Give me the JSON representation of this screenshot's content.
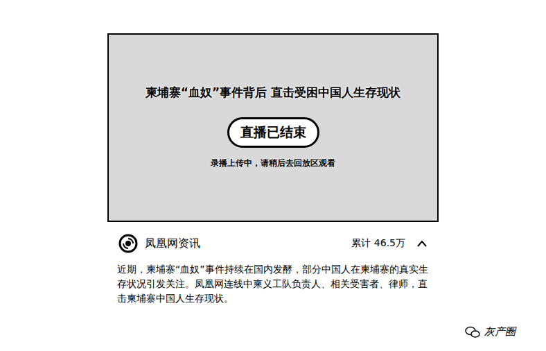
{
  "video": {
    "title": "柬埔寨“血奴”事件背后 直击受困中国人生存现状",
    "status": "直播已结束",
    "notice": "录播上传中，请稍后去回放区观看"
  },
  "channel": {
    "name": "凤凰网资讯",
    "views_label": "累计",
    "views": "46.5万"
  },
  "description": "近期，柬埔寨“血奴”事件持续在国内发酵，部分中国人在柬埔寨的真实生存状况引发关注。凤凰网连线中柬义工队负责人、相关受害者、律师，直击柬埔寨中国人生存现状。",
  "watermark": "灰产圈"
}
